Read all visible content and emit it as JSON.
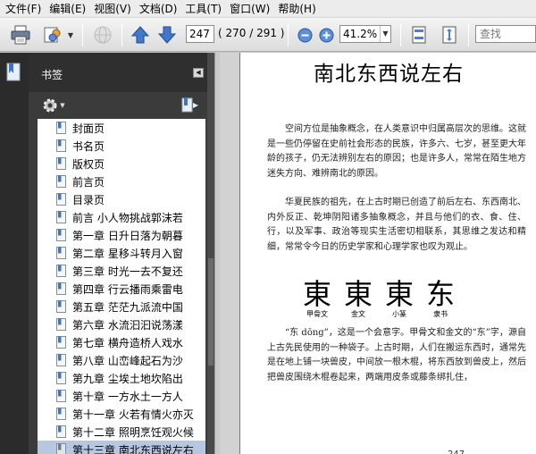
{
  "menu": [
    "文件(F)",
    "编辑(E)",
    "视图(V)",
    "文档(D)",
    "工具(T)",
    "窗口(W)",
    "帮助(H)"
  ],
  "toolbar": {
    "page_current": "247",
    "page_count": "( 270 / 291 )",
    "zoom": "41.2%",
    "search_placeholder": "查找"
  },
  "panel": {
    "title": "书签",
    "bookmarks": [
      "封面页",
      "书名页",
      "版权页",
      "前言页",
      "目录页",
      "前言 小人物挑战郭沫若",
      "第一章 日升日落为朝暮",
      "第二章 星移斗转月入窗",
      "第三章 时光一去不复还",
      "第四章 行云播雨乘雷电",
      "第五章 茫茫九派流中国",
      "第六章 水流汩汩说荡漾",
      "第七章 横舟造桥人戏水",
      "第八章 山峦峰起石为沙",
      "第九章 尘埃土地坎陷出",
      "第十章 一方水土一方人",
      "第十一章 火若有情火亦灭",
      "第十二章 照明烹饪观火候",
      "第十三章 南北东西说左右"
    ],
    "selected_index": 18
  },
  "document": {
    "title": "南北东西说左右",
    "paragraphs": [
      "空间方位是抽象概念，在人类意识中归属高层次的思维。这就是一些仍停留在史前社会形态的民族，许多六、七岁，甚至更大年龄的孩子，仍无法辨别左右的原因；也是许多人，常常在陌生地方迷失方向、难辨南北的原因。",
      "华夏民族的祖先，在上古时期已创造了前后左右、东西南北、内外反正、乾坤阴阳诸多抽象概念，并且与他们的衣、食、住、行，以及军事、政治等现实生活密切相联系，其思维之发达和精细，常常令今日的历史学家和心理学家也叹为观止。",
      "“东 dōng”，这是一个会意字。甲骨文和金文的“东”字，源自上古先民使用的一种袋子。上古时期，人们在搬运东西时，通常先是在地上铺一块兽皮，中间放一根木棍，将东西放到兽皮上，然后把兽皮围绕木棍卷起来，两端用皮条或藤条绑扎住，"
    ],
    "glyphs": [
      {
        "char": "東",
        "caption": "甲骨文"
      },
      {
        "char": "東",
        "caption": "金文"
      },
      {
        "char": "東",
        "caption": "小篆"
      },
      {
        "char": "东",
        "caption": "隶书"
      }
    ],
    "page_number": "247"
  }
}
